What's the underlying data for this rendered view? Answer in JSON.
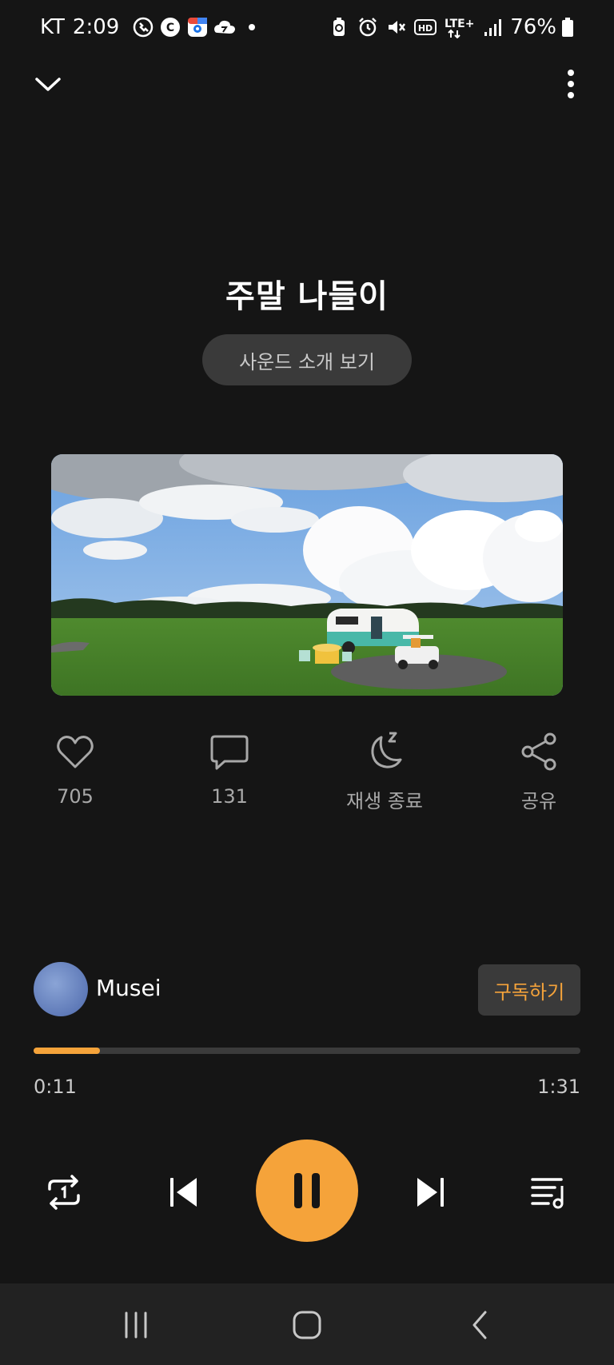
{
  "status_bar": {
    "carrier": "KT",
    "time": "2:09",
    "left_icons": [
      "call-icon",
      "c-app-icon",
      "map-app-icon",
      "cloud-app-icon",
      "dot-icon"
    ],
    "right_icons": [
      "battery-saver-icon",
      "alarm-icon",
      "mute-icon",
      "hd-icon",
      "lte-plus-icon",
      "signal-icon"
    ],
    "network": "LTE+",
    "battery_percent": "76%"
  },
  "player": {
    "title": "주말 나들이",
    "intro_button": "사운드 소개 보기",
    "artwork": {
      "subject": "camper-trailer-on-grass-field"
    },
    "actions": {
      "like_count": "705",
      "comment_count": "131",
      "sleep_label": "재생 종료",
      "share_label": "공유"
    },
    "artist": {
      "name": "Musei",
      "subscribe_label": "구독하기"
    },
    "progress": {
      "current": "0:11",
      "total": "1:31",
      "fraction": 0.121
    },
    "controls": [
      "repeat-icon",
      "previous-icon",
      "pause-icon",
      "next-icon",
      "playlist-icon"
    ]
  },
  "nav_bar": [
    "recent-apps-icon",
    "home-icon",
    "back-icon"
  ],
  "colors": {
    "background": "#151515",
    "accent": "#f5a33a",
    "muted_text": "#a8a8a8",
    "chip_bg": "#3a3a3a"
  }
}
